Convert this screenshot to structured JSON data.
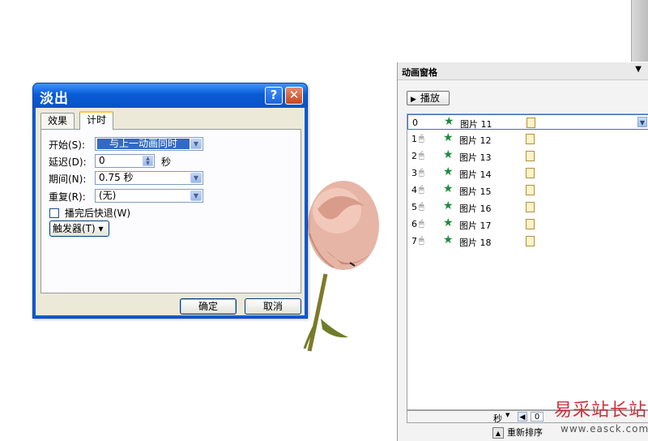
{
  "dialog": {
    "title": "淡出",
    "help_label": "?",
    "close_label": "✕",
    "tabs": [
      {
        "label": "效果"
      },
      {
        "label": "计时"
      }
    ],
    "start_label": "开始(S):",
    "start_value": "与上一动画同时",
    "delay_label": "延迟(D):",
    "delay_value": "0",
    "delay_unit": "秒",
    "duration_label": "期间(N):",
    "duration_value": "0.75 秒",
    "repeat_label": "重复(R):",
    "repeat_value": "(无)",
    "rewind_label": "播完后快退(W)",
    "trigger_label": "触发器(T) ▾",
    "ok_label": "确定",
    "cancel_label": "取消"
  },
  "pane": {
    "title": "动画窗格",
    "menu_icon": "▼",
    "play_label": "播放",
    "items": [
      {
        "num": "0",
        "label": "图片 11"
      },
      {
        "num": "1",
        "label": "图片 12"
      },
      {
        "num": "2",
        "label": "图片 13"
      },
      {
        "num": "3",
        "label": "图片 14"
      },
      {
        "num": "4",
        "label": "图片 15"
      },
      {
        "num": "5",
        "label": "图片 16"
      },
      {
        "num": "6",
        "label": "图片 17"
      },
      {
        "num": "7",
        "label": "图片 18"
      }
    ],
    "seconds_label": "秒",
    "zoom_value": "0",
    "reorder_label": "重新排序"
  },
  "watermark": {
    "cn": "易采站长站",
    "en": "www.easck.com"
  },
  "colors": {
    "title_bar": "#0a5bd6",
    "close_button": "#c8461c",
    "selection": "#316ac5",
    "star_icon": "#1d8a3e",
    "watermark": "#c8323c"
  }
}
